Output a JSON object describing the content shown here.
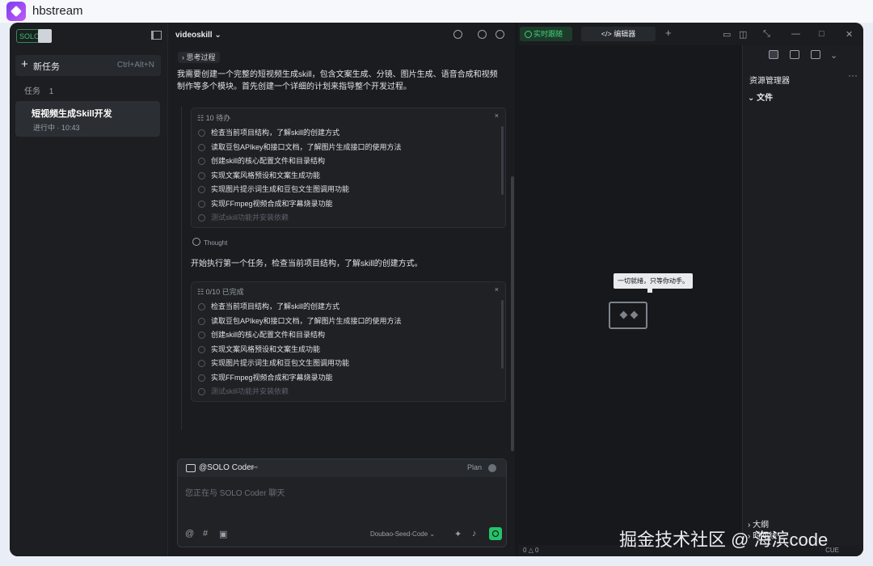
{
  "app_title": "hbstream",
  "sidebar": {
    "logo_text": "SOLO",
    "new_task_label": "新任务",
    "new_task_shortcut": "Ctrl+Alt+N",
    "tasks_header": "任务",
    "tasks_count": "1",
    "task": {
      "title": "短视频生成Skill开发",
      "status": "进行中 · 10:43"
    }
  },
  "chat": {
    "project_name": "videoskill",
    "thinking_label": "思考过程",
    "intro": "我需要创建一个完整的短视频生成skill，包含文案生成、分镜、图片生成、语音合成和视频制作等多个模块。首先创建一个详细的计划来指导整个开发过程。",
    "todo1": {
      "header": "10 待办",
      "items": [
        "检查当前项目结构，了解skill的创建方式",
        "读取豆包APIkey和接口文档，了解图片生成接口的使用方法",
        "创建skill的核心配置文件和目录结构",
        "实现文案风格预设和文案生成功能",
        "实现图片提示词生成和豆包文生图调用功能",
        "实现FFmpeg视频合成和字幕烧录功能",
        "测试skill功能并安装依赖"
      ]
    },
    "thought_label": "Thought",
    "thought_text": "开始执行第一个任务，检查当前项目结构，了解skill的创建方式。",
    "todo2": {
      "header": "0/10 已完成",
      "items": [
        "检查当前项目结构，了解skill的创建方式",
        "读取豆包APIkey和接口文档，了解图片生成接口的使用方法",
        "创建skill的核心配置文件和目录结构",
        "实现文案风格预设和文案生成功能",
        "实现图片提示词生成和豆包文生图调用功能",
        "实现FFmpeg视频合成和字幕烧录功能",
        "测试skill功能并安装依赖"
      ]
    },
    "composer": {
      "agent": "@SOLO Coder",
      "plan_label": "Plan",
      "placeholder": "您正在与 SOLO Coder 聊天",
      "model": "Doubao-Seed-Code"
    }
  },
  "editor": {
    "tab_preview": "实时跟随",
    "tab_editor": "编辑器",
    "tooltip": "一切就绪，只等你动手。"
  },
  "explorer": {
    "title": "资源管理器",
    "files_label": "文件",
    "outline_label": "大纲",
    "timeline_label": "时间线"
  },
  "statusbar": {
    "left": "0 △ 0",
    "right": "CUE"
  },
  "watermark": "掘金技术社区 @ 海滨code",
  "colors": {
    "accent": "#25c26a",
    "background": "#16181c"
  }
}
